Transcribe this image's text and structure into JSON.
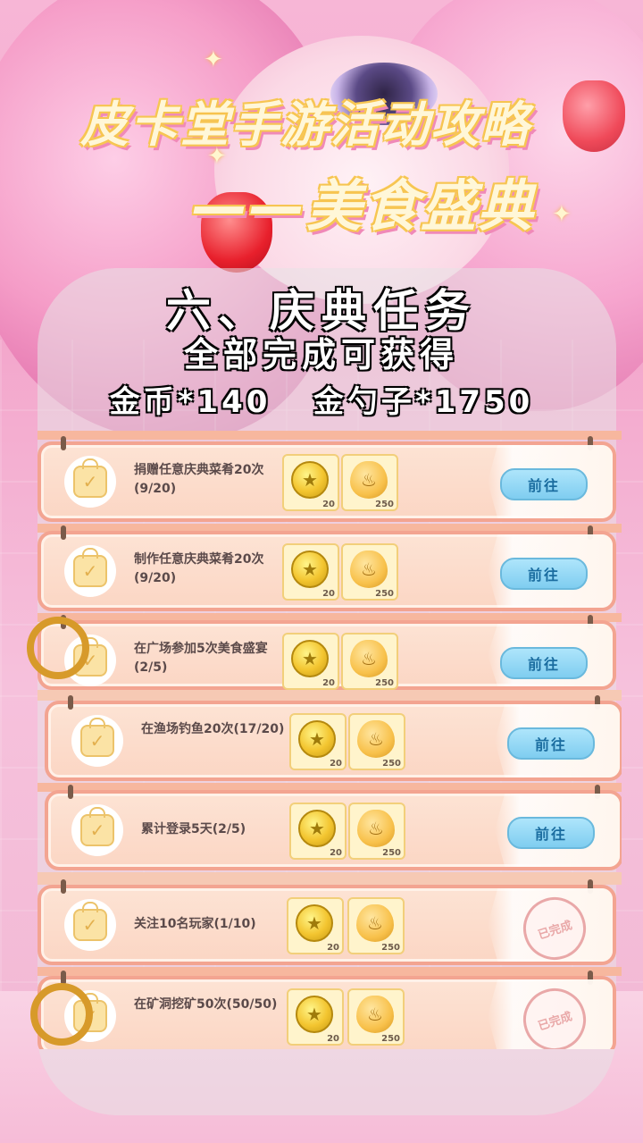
{
  "title": {
    "line1": "皮卡堂手游活动攻略",
    "line2": "——美食盛典"
  },
  "section": {
    "heading": "六、庆典任务",
    "subheading": "全部完成可获得",
    "reward_summary": "金币*140   金勺子*1750"
  },
  "tasks": [
    {
      "desc": "捐赠任意庆典菜肴20次(9/20)",
      "coin_qty": "20",
      "spoon_qty": "250",
      "action": "前往",
      "status": "open"
    },
    {
      "desc": "制作任意庆典菜肴20次(9/20)",
      "coin_qty": "20",
      "spoon_qty": "250",
      "action": "前往",
      "status": "open"
    },
    {
      "desc": "在广场参加5次美食盛宴(2/5)",
      "coin_qty": "20",
      "spoon_qty": "250",
      "action": "前往",
      "status": "open"
    },
    {
      "desc": "在渔场钓鱼20次(17/20)",
      "coin_qty": "20",
      "spoon_qty": "250",
      "action": "前往",
      "status": "open"
    },
    {
      "desc": "累计登录5天(2/5)",
      "coin_qty": "20",
      "spoon_qty": "250",
      "action": "前往",
      "status": "open"
    },
    {
      "desc": "关注10名玩家(1/10)",
      "coin_qty": "20",
      "spoon_qty": "250",
      "action": "已完成",
      "status": "done"
    },
    {
      "desc": "在矿洞挖矿50次(50/50)",
      "coin_qty": "20",
      "spoon_qty": "250",
      "action": "已完成",
      "status": "done"
    }
  ],
  "icons": {
    "task": "task-bag-icon",
    "coin": "gold-coin-icon",
    "spoon": "gold-spoon-icon",
    "done": "completed-stamp-icon"
  },
  "colors": {
    "go_button": "#7fcdf0",
    "card_border": "#f3a491",
    "title_fill": "#fff7d8"
  }
}
